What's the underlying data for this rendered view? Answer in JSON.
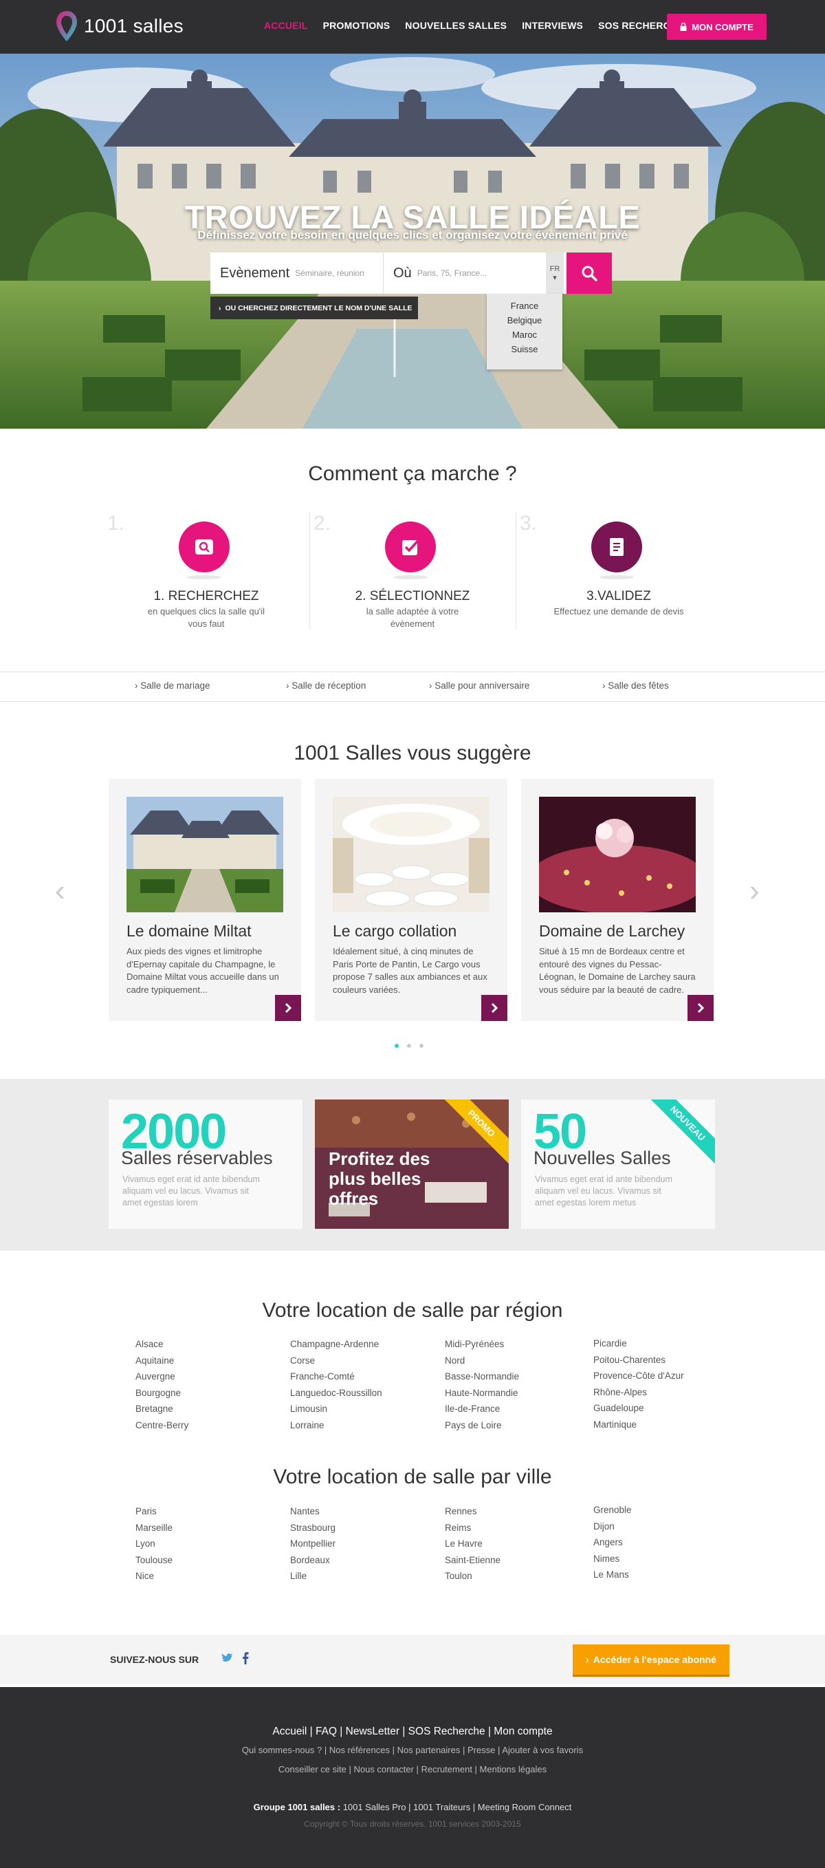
{
  "header": {
    "brand": "1001 salles",
    "nav": [
      "ACCUEIL",
      "PROMOTIONS",
      "NOUVELLES SALLES",
      "INTERVIEWS",
      "SOS RECHERCHE"
    ],
    "account": "MON COMPTE"
  },
  "hero": {
    "title": "TROUVEZ LA SALLE IDÉALE",
    "subtitle": "Définissez votre besoin en quelques clics et organisez votre évènement privé",
    "event_label": "Evènement",
    "event_placeholder": "Séminaire, réunion",
    "where_label": "Où",
    "where_placeholder": "Paris, 75, France...",
    "lang": "FR",
    "direct_link": "OU CHERCHEZ DIRECTEMENT LE NOM D'UNE SALLE",
    "countries": [
      "France",
      "Belgique",
      "Maroc",
      "Suisse"
    ]
  },
  "how": {
    "title": "Comment ça marche ?",
    "steps": [
      {
        "num": "1.",
        "title": "1. RECHERCHEZ",
        "desc": "en quelques clics la salle qu'il vous faut"
      },
      {
        "num": "2.",
        "title": "2. SÉLECTIONNEZ",
        "desc": "la salle adaptée à votre évènement"
      },
      {
        "num": "3.",
        "title": "3.VALIDEZ",
        "desc": "Effectuez une demande de devis"
      }
    ]
  },
  "categories": [
    "Salle de mariage",
    "Salle de réception",
    "Salle pour anniversaire",
    "Salle des fêtes"
  ],
  "suggest": {
    "title": "1001 Salles vous suggère",
    "cards": [
      {
        "title": "Le domaine Miltat",
        "desc": "Aux pieds des vignes et limitrophe d'Epernay capitale du Champagne, le Domaine Miltat vous accueille dans un cadre typiquement..."
      },
      {
        "title": "Le cargo collation",
        "desc": "Idéalement situé, à cinq minutes de Paris Porte de Pantin, Le Cargo vous propose 7 salles aux ambiances et aux couleurs variées."
      },
      {
        "title": "Domaine de Larchey",
        "desc": "Situé à 15 mn de Bordeaux centre et entouré des vignes du Pessac-Léognan, le Domaine de Larchey saura vous séduire par la beauté de cadre."
      }
    ]
  },
  "promo": {
    "box1": {
      "big": "2000",
      "label": "Salles réservables",
      "text": "Vivamus eget erat id ante bibendum aliquam vel eu lacus. Vivamus sit amet egestas lorem"
    },
    "box2": {
      "ribbon": "PROMO",
      "text": "Profitez des plus belles offres"
    },
    "box3": {
      "big": "50",
      "label": "Nouvelles Salles",
      "ribbon": "NOUVEAU",
      "text": "Vivamus eget erat id ante bibendum aliquam vel eu lacus. Vivamus sit amet egestas lorem metus"
    }
  },
  "regions": {
    "title": "Votre location de salle par région",
    "cols": [
      [
        "Alsace",
        "Aquitaine",
        "Auvergne",
        "Bourgogne",
        "Bretagne",
        "Centre-Berry"
      ],
      [
        "Champagne-Ardenne",
        "Corse",
        "Franche-Comté",
        "Languedoc-Roussillon",
        "Limousin",
        "Lorraine"
      ],
      [
        "Midi-Pyrénées",
        "Nord",
        "Basse-Normandie",
        "Haute-Normandie",
        "Ile-de-France",
        "Pays de Loire"
      ],
      [
        "Picardie",
        "Poitou-Charentes",
        "Provence-Côte d'Azur",
        "Rhône-Alpes",
        "Guadeloupe",
        "Martinique"
      ]
    ]
  },
  "cities": {
    "title": "Votre location de salle par ville",
    "cols": [
      [
        "Paris",
        "Marseille",
        "Lyon",
        "Toulouse",
        "Nice"
      ],
      [
        "Nantes",
        "Strasbourg",
        "Montpellier",
        "Bordeaux",
        "Lille"
      ],
      [
        "Rennes",
        "Reims",
        "Le Havre",
        "Saint-Etienne",
        "Toulon"
      ],
      [
        "Grenoble",
        "Dijon",
        "Angers",
        "Nimes",
        "Le Mans"
      ]
    ]
  },
  "follow": {
    "label": "SUIVEZ-NOUS SUR",
    "button": "Accéder à l'espace abonné"
  },
  "footer": {
    "line1": "Accueil  |  FAQ  |  NewsLetter  |  SOS Recherche  |  Mon compte",
    "line2": "Qui sommes-nous ?  |  Nos références  |  Nos partenaires  |  Presse  |  Ajouter à vos favoris",
    "line3": "Conseiller ce site  |  Nous contacter  |  Recrutement  |  Mentions légales",
    "group_label": "Groupe 1001 salles :",
    "group_links": "1001 Salles Pro  |  1001 Traiteurs  |  Meeting Room Connect",
    "copyright": "Copyright © Tous droits réservés. 1001 services 2003-2015"
  },
  "colors": {
    "pink": "#e6157e",
    "purple": "#7a1553",
    "teal": "#21d3bd",
    "orange": "#f7a000",
    "dark": "#2f2f31"
  }
}
